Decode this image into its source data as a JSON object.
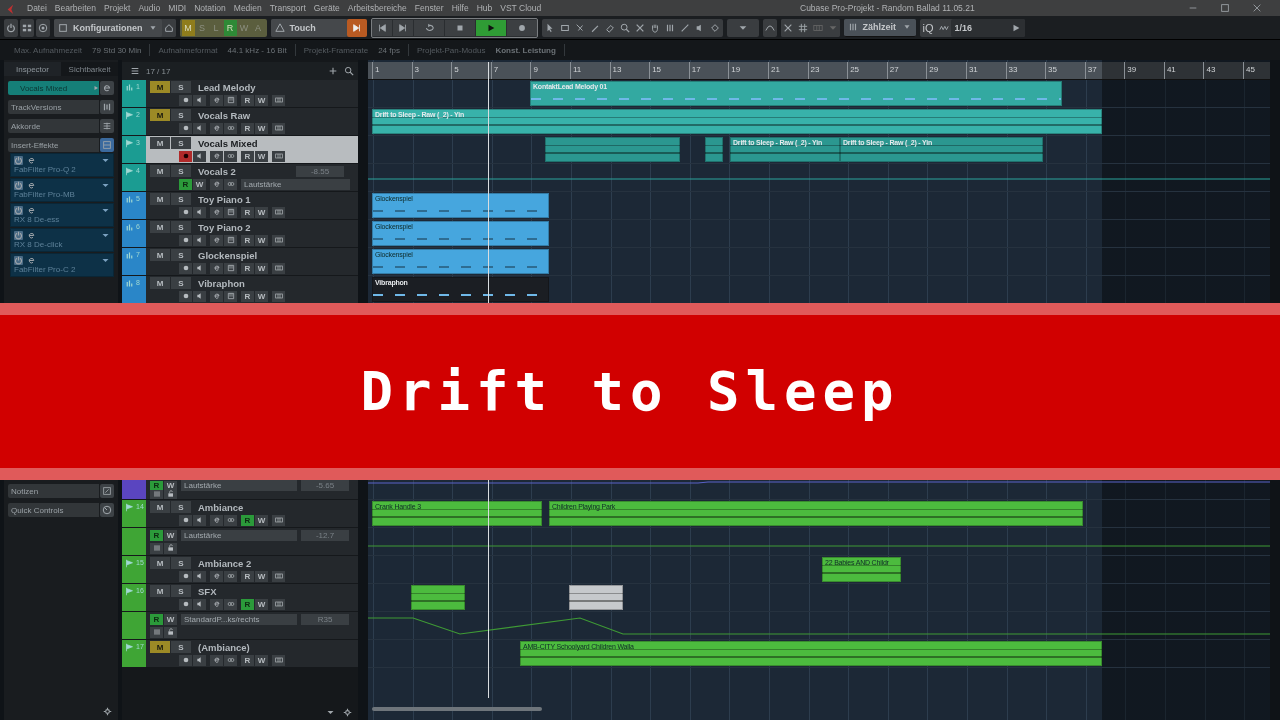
{
  "window": {
    "title": "Cubase Pro-Projekt - Random Ballad 11.05.21"
  },
  "menu": [
    "Datei",
    "Bearbeiten",
    "Projekt",
    "Audio",
    "MIDI",
    "Notation",
    "Medien",
    "Transport",
    "Geräte",
    "Arbeitsbereiche",
    "Fenster",
    "Hilfe",
    "Hub",
    "VST Cloud"
  ],
  "toolbar": {
    "configurations": "Konfigurationen",
    "automation_buttons": [
      {
        "label": "M",
        "on": true,
        "color": "#8f7d1c"
      },
      {
        "label": "S",
        "on": false
      },
      {
        "label": "L",
        "on": false
      },
      {
        "label": "R",
        "on": true,
        "color": "#2e8a36"
      },
      {
        "label": "W",
        "on": false
      },
      {
        "label": "A",
        "on": false
      }
    ],
    "automation_mode": "Touch",
    "transport": [
      {
        "kind": "previous",
        "on": false
      },
      {
        "kind": "next",
        "on": false
      },
      {
        "kind": "cycle",
        "on": false
      },
      {
        "kind": "stop",
        "on": false
      },
      {
        "kind": "play",
        "on": true
      },
      {
        "kind": "record",
        "on": false
      }
    ],
    "ruler_format": "Zählzeit",
    "iq": "iQ",
    "quantize": "1/16"
  },
  "info_line": [
    {
      "label": "Max. Aufnahmezeit",
      "value": "79 Std 30 Min"
    },
    {
      "label": "Aufnahmeformat",
      "value": "44.1 kHz - 16 Bit"
    },
    {
      "label": "Projekt-Framerate",
      "value": "24 fps"
    },
    {
      "label": "Projekt-Pan-Modus",
      "value": "Konst. Leistung"
    }
  ],
  "inspector": {
    "tabs": [
      {
        "label": "Inspector",
        "selected": true
      },
      {
        "label": "Sichtbarkeit",
        "selected": false
      }
    ],
    "track": "Vocals Mixed",
    "sections": [
      "TrackVersions",
      "Akkorde",
      "Insert-Effekte"
    ],
    "inserts": [
      "FabFilter Pro-Q 2",
      "FabFilter Pro-MB",
      "RX 8 De-ess",
      "RX 8 De-click",
      "FabFilter Pro-C 2"
    ],
    "lower_sections": [
      "Notizen",
      "Quick Controls"
    ]
  },
  "track_list": {
    "count": "17 / 17",
    "upper": [
      {
        "number": "1",
        "name": "Lead Melody",
        "kind": "instrument",
        "color": "#1b9c92",
        "selected": false,
        "mute_label": "M",
        "mute": true,
        "solo_label": "S",
        "solo": false,
        "record": false,
        "read_label": "R",
        "read": false,
        "write_label": "W"
      },
      {
        "number": "2",
        "name": "Vocals Raw",
        "kind": "audio",
        "color": "#1b9c92",
        "selected": false,
        "mute_label": "M",
        "mute": true,
        "solo_label": "S",
        "solo": false,
        "record": false,
        "read_label": "R",
        "read": false,
        "write_label": "W"
      },
      {
        "number": "3",
        "name": "Vocals Mixed",
        "kind": "audio",
        "color": "#1b9c92",
        "selected": true,
        "mute_label": "M",
        "mute": false,
        "solo_label": "S",
        "solo": false,
        "record": true,
        "read_label": "R",
        "read": false,
        "write_label": "W"
      },
      {
        "number": "4",
        "name": "Vocals 2",
        "kind": "group",
        "color": "#1b9c92",
        "selected": false,
        "mute_label": "M",
        "mute": false,
        "solo_label": "S",
        "solo": false,
        "read_label": "R",
        "read": true,
        "write_label": "W",
        "param": "Lautstärke",
        "value": "-8.55"
      },
      {
        "number": "5",
        "name": "Toy Piano 1",
        "kind": "instrument",
        "color": "#2a86c8",
        "selected": false,
        "mute_label": "M",
        "mute": false,
        "solo_label": "S",
        "solo": false,
        "record": false,
        "read_label": "R",
        "read": false,
        "write_label": "W"
      },
      {
        "number": "6",
        "name": "Toy Piano 2",
        "kind": "instrument",
        "color": "#2a86c8",
        "selected": false,
        "mute_label": "M",
        "mute": false,
        "solo_label": "S",
        "solo": false,
        "record": false,
        "read_label": "R",
        "read": false,
        "write_label": "W"
      },
      {
        "number": "7",
        "name": "Glockenspiel",
        "kind": "instrument",
        "color": "#2a86c8",
        "selected": false,
        "mute_label": "M",
        "mute": false,
        "solo_label": "S",
        "solo": false,
        "record": false,
        "read_label": "R",
        "read": false,
        "write_label": "W"
      },
      {
        "number": "8",
        "name": "Vibraphon",
        "kind": "instrument",
        "color": "#2a86c8",
        "selected": false,
        "mute_label": "M",
        "mute": false,
        "solo_label": "S",
        "solo": false,
        "record": false,
        "read_label": "R",
        "read": false,
        "write_label": "W"
      }
    ],
    "lower": [
      {
        "kind": "automation",
        "color": "#5a45c0",
        "read_label": "R",
        "read": true,
        "write_label": "W",
        "param": "Lautstärke",
        "value": "-5.65"
      },
      {
        "number": "14",
        "name": "Ambiance",
        "kind": "audio",
        "color": "#3fa535",
        "selected": false,
        "mute_label": "M",
        "mute": false,
        "solo_label": "S",
        "solo": false,
        "record": false,
        "read_label": "R",
        "read": true,
        "write_label": "W"
      },
      {
        "kind": "automation",
        "color": "#3fa535",
        "read_label": "R",
        "read": true,
        "write_label": "W",
        "param": "Lautstärke",
        "value": "-12.7"
      },
      {
        "number": "15",
        "name": "Ambiance 2",
        "kind": "audio",
        "color": "#3fa535",
        "selected": false,
        "mute_label": "M",
        "mute": false,
        "solo_label": "S",
        "solo": false,
        "record": false,
        "read_label": "R",
        "read": false,
        "write_label": "W"
      },
      {
        "number": "16",
        "name": "SFX",
        "kind": "audio",
        "color": "#3fa535",
        "selected": false,
        "mute_label": "M",
        "mute": false,
        "solo_label": "S",
        "solo": false,
        "record": false,
        "read_label": "R",
        "read": true,
        "write_label": "W"
      },
      {
        "kind": "automation",
        "color": "#3fa535",
        "read_label": "R",
        "read": true,
        "write_label": "W",
        "param": "StandardP...ks/rechts",
        "value": "R35"
      },
      {
        "number": "17",
        "name": "(Ambiance)",
        "kind": "audio",
        "color": "#3fa535",
        "selected": false,
        "mute_label": "M",
        "mute": true,
        "solo_label": "S",
        "solo": false,
        "record": false,
        "read_label": "R",
        "read": false,
        "write_label": "W"
      }
    ]
  },
  "arrange": {
    "ruler": [
      "1",
      "3",
      "5",
      "7",
      "9",
      "11",
      "13",
      "15",
      "17",
      "19",
      "21",
      "23",
      "25",
      "27",
      "29",
      "31",
      "33",
      "35",
      "37",
      "39",
      "41",
      "43",
      "45"
    ],
    "upper_lanes": [
      {
        "kind": "track",
        "events": [
          {
            "kind": "midi",
            "label": "KontaktLead Melody 01",
            "color": "#33a9a1"
          }
        ]
      },
      {
        "kind": "track",
        "events": [
          {
            "kind": "audio",
            "label": "Drift to Sleep - Raw (_2) - Yin",
            "color": "#38b2aa"
          }
        ]
      },
      {
        "kind": "track",
        "events": [
          {
            "kind": "audio",
            "color": "#2b9790"
          },
          {
            "kind": "audio",
            "color": "#2b9790"
          },
          {
            "kind": "audio",
            "label": "Drift to Sleep - Raw (_2) - Yin",
            "color": "#2b9790"
          },
          {
            "kind": "audio",
            "label": "Drift to Sleep - Raw (_2) - Yin",
            "color": "#2b9790"
          }
        ]
      },
      {
        "kind": "automation"
      },
      {
        "kind": "track",
        "events": [
          {
            "kind": "midi",
            "label": "Glockenspiel",
            "color": "#46a6de"
          }
        ]
      },
      {
        "kind": "track",
        "events": [
          {
            "kind": "midi",
            "label": "Glockenspiel",
            "color": "#46a6de"
          }
        ]
      },
      {
        "kind": "track",
        "events": [
          {
            "kind": "midi",
            "label": "Glockenspiel",
            "color": "#46a6de"
          }
        ]
      },
      {
        "kind": "track",
        "events": [
          {
            "kind": "midi",
            "label": "Vibraphon",
            "color": "#1b1e23"
          }
        ]
      }
    ],
    "lower_lanes": [
      {
        "kind": "automation"
      },
      {
        "kind": "track",
        "events": [
          {
            "kind": "audio",
            "label": "Crank Handle 3",
            "color": "#4cbb3e"
          },
          {
            "kind": "audio",
            "label": "Children Playing Park",
            "color": "#4cbb3e"
          }
        ]
      },
      {
        "kind": "automation"
      },
      {
        "kind": "track",
        "events": [
          {
            "kind": "audio",
            "label": "22 Babies AND Childr",
            "color": "#4cbb3e"
          }
        ]
      },
      {
        "kind": "track",
        "events": [
          {
            "kind": "audio",
            "color": "#4cbb3e"
          },
          {
            "kind": "audio",
            "color": "#c6c9cc"
          }
        ]
      },
      {
        "kind": "automation"
      },
      {
        "kind": "track",
        "events": [
          {
            "kind": "audio",
            "label": "AMB-CITY Schoolyard Children Walla",
            "color": "#4cbb3e"
          }
        ]
      }
    ]
  },
  "banner": {
    "title": "Drift to Sleep"
  }
}
